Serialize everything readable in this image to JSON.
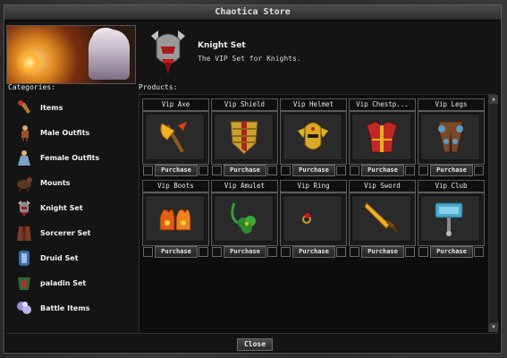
{
  "window": {
    "title": "Chaotica Store"
  },
  "featured": {
    "title": "Knight Set",
    "description": "The VIP Set for Knights."
  },
  "categories_label": "Categories:",
  "products_label": "Products:",
  "categories": [
    {
      "label": "Items",
      "icon": "items-icon"
    },
    {
      "label": "Male Outfits",
      "icon": "male-outfit-icon"
    },
    {
      "label": "Female Outfits",
      "icon": "female-outfit-icon"
    },
    {
      "label": "Mounts",
      "icon": "mount-icon"
    },
    {
      "label": "Knight Set",
      "icon": "knight-helmet-icon"
    },
    {
      "label": "Sorcerer Set",
      "icon": "sorcerer-robe-icon"
    },
    {
      "label": "Druid Set",
      "icon": "druid-armor-icon"
    },
    {
      "label": "paladin Set",
      "icon": "paladin-armor-icon"
    },
    {
      "label": "Battle Items",
      "icon": "battle-items-icon"
    }
  ],
  "products": [
    {
      "name": "Vip Axe",
      "icon": "axe-icon",
      "button": "Purchase"
    },
    {
      "name": "Vip Shield",
      "icon": "shield-icon",
      "button": "Purchase"
    },
    {
      "name": "Vip Helmet",
      "icon": "helmet-icon",
      "button": "Purchase"
    },
    {
      "name": "Vip Chestp...",
      "icon": "chestplate-icon",
      "button": "Purchase"
    },
    {
      "name": "Vip Legs",
      "icon": "legs-icon",
      "button": "Purchase"
    },
    {
      "name": "Vip Boots",
      "icon": "boots-icon",
      "button": "Purchase"
    },
    {
      "name": "Vip Amulet",
      "icon": "amulet-icon",
      "button": "Purchase"
    },
    {
      "name": "Vip Ring",
      "icon": "ring-icon",
      "button": "Purchase"
    },
    {
      "name": "Vip Sword",
      "icon": "sword-icon",
      "button": "Purchase"
    },
    {
      "name": "Vip Club",
      "icon": "club-icon",
      "button": "Purchase"
    }
  ],
  "footer": {
    "close_label": "Close"
  }
}
